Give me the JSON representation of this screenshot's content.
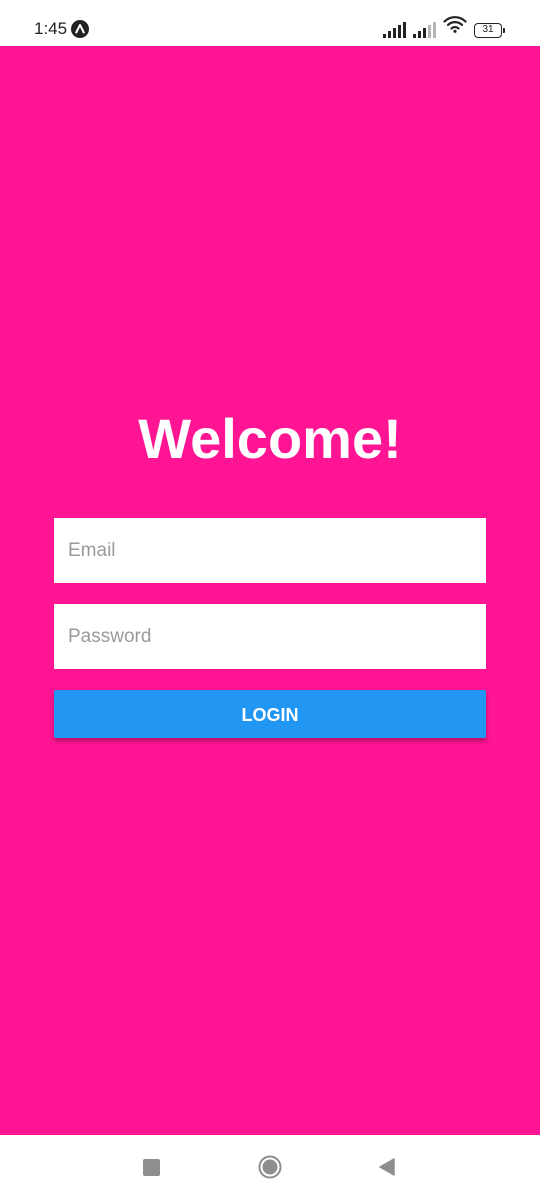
{
  "status_bar": {
    "time": "1:45",
    "battery_level": "31",
    "icons": [
      "app-notification-icon",
      "signal-icon",
      "signal-icon",
      "wifi-icon",
      "battery-icon"
    ]
  },
  "colors": {
    "background": "#FF1493",
    "button": "#2196F3",
    "field": "#FFFFFF"
  },
  "login": {
    "title": "Welcome!",
    "email_placeholder": "Email",
    "password_placeholder": "Password",
    "button_label": "LOGIN"
  },
  "nav_bar": {
    "icons": [
      "recents-icon",
      "home-icon",
      "back-icon"
    ]
  }
}
